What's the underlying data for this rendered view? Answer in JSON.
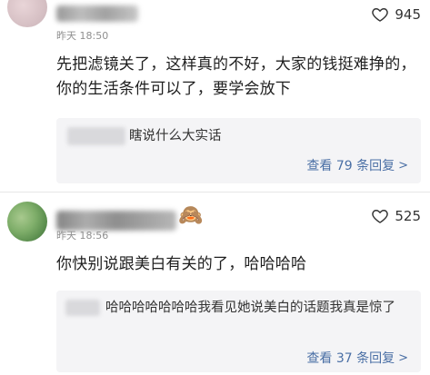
{
  "comments": [
    {
      "username_visible": "",
      "time": "昨天 18:50",
      "likes": "945",
      "text": "先把滤镜关了，这样真的不好，大家的钱挺难挣的，你的生活条件可以了，要学会放下",
      "reply": {
        "text": "瞎说什么大实话"
      },
      "view_replies": "查看 79 条回复"
    },
    {
      "username_visible": "",
      "badge_emoji": "🙈",
      "time": "昨天 18:56",
      "likes": "525",
      "text": "你快别说跟美白有关的了，哈哈哈哈",
      "reply": {
        "text": "哈哈哈哈哈哈哈我看见她说美白的话题我真是惊了"
      },
      "view_replies": "查看 37 条回复"
    }
  ],
  "icons": {
    "like": "heart-outline-icon",
    "chevron": "chevron-right-icon"
  },
  "colors": {
    "link": "#4a6fa5",
    "reply_bg": "#f4f4f6",
    "meta": "#8f8f8f"
  }
}
